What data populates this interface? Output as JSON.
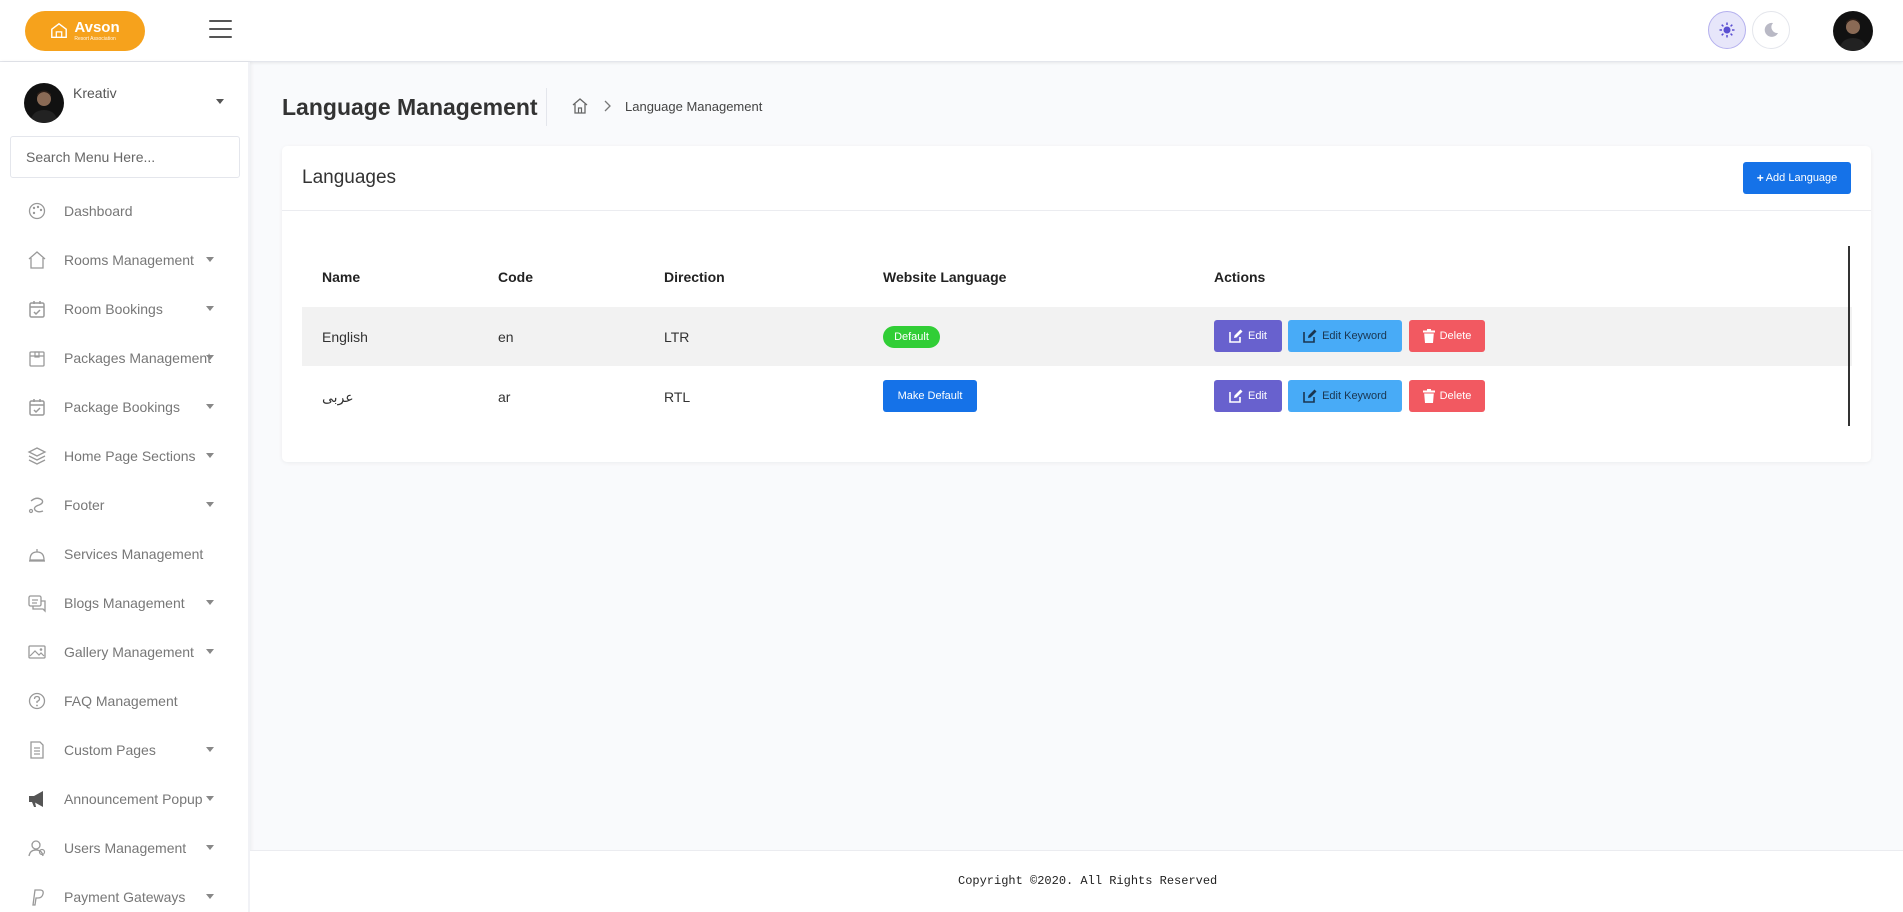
{
  "header": {
    "logo_name": "Avson",
    "logo_tagline": "Resort Association"
  },
  "sidebar": {
    "user_name": "Kreativ",
    "search_placeholder": "Search Menu Here...",
    "items": [
      {
        "label": "Dashboard",
        "icon": "palette-icon",
        "has_caret": false
      },
      {
        "label": "Rooms Management",
        "icon": "home-icon",
        "has_caret": true
      },
      {
        "label": "Room Bookings",
        "icon": "calendar-check-icon",
        "has_caret": true
      },
      {
        "label": "Packages Management",
        "icon": "package-icon",
        "has_caret": true
      },
      {
        "label": "Package Bookings",
        "icon": "calendar-check-icon",
        "has_caret": true
      },
      {
        "label": "Home Page Sections",
        "icon": "layers-icon",
        "has_caret": true
      },
      {
        "label": "Footer",
        "icon": "footer-icon",
        "has_caret": true
      },
      {
        "label": "Services Management",
        "icon": "bell-service-icon",
        "has_caret": false
      },
      {
        "label": "Blogs Management",
        "icon": "chat-icon",
        "has_caret": true
      },
      {
        "label": "Gallery Management",
        "icon": "image-icon",
        "has_caret": true
      },
      {
        "label": "FAQ Management",
        "icon": "question-icon",
        "has_caret": false
      },
      {
        "label": "Custom Pages",
        "icon": "document-icon",
        "has_caret": true
      },
      {
        "label": "Announcement Popup",
        "icon": "megaphone-icon",
        "has_caret": true
      },
      {
        "label": "Users Management",
        "icon": "user-icon",
        "has_caret": true
      },
      {
        "label": "Payment Gateways",
        "icon": "paypal-icon",
        "has_caret": true
      }
    ]
  },
  "page": {
    "title": "Language Management",
    "breadcrumb": "Language Management"
  },
  "card": {
    "title": "Languages",
    "add_button": "Add Language",
    "columns": [
      "Name",
      "Code",
      "Direction",
      "Website Language",
      "Actions"
    ],
    "rows": [
      {
        "name": "English",
        "code": "en",
        "direction": "LTR",
        "website_language": "Default",
        "is_default": true
      },
      {
        "name": "عربى",
        "code": "ar",
        "direction": "RTL",
        "website_language": "Make Default",
        "is_default": false
      }
    ],
    "actions": {
      "edit": "Edit",
      "edit_keyword": "Edit Keyword",
      "delete": "Delete"
    }
  },
  "footer": {
    "copyright": "Copyright ©2020. All Rights Reserved"
  },
  "colors": {
    "brand": "#f6a21c",
    "primary": "#1572e8",
    "edit": "#6861ce",
    "edit_keyword": "#48abf7",
    "delete": "#f25961",
    "success": "#31ce36"
  }
}
